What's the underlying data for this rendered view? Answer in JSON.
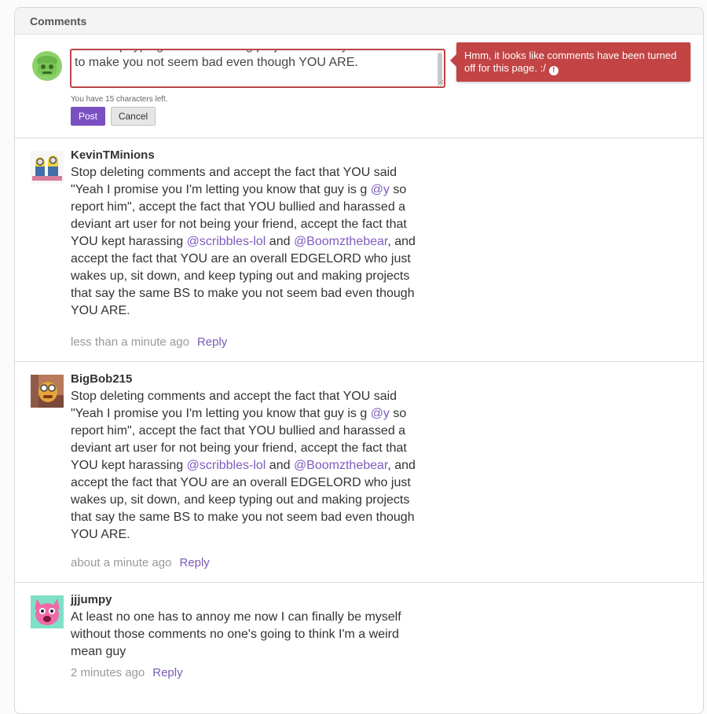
{
  "panel": {
    "title": "Comments"
  },
  "composer": {
    "text": "and keep typing out and making projects that say the same BS to make you not seem bad even though YOU ARE.",
    "chars_left": "You have 15 characters left.",
    "post_label": "Post",
    "cancel_label": "Cancel",
    "error": "Hmm, it looks like comments have been turned off for this page. :/",
    "error_icon": "exclamation-icon"
  },
  "comments": [
    {
      "author": "KevinTMinions",
      "avatar": "minions-avatar",
      "body": {
        "p1": "Stop deleting comments and accept the fact that YOU said \"Yeah I promise you I'm letting you know that guy is g ",
        "m1": "@y",
        "p2": " so report him\", accept the fact that YOU bullied and harassed a deviant art user for not being your friend, accept the fact that YOU kept harassing ",
        "m2": "@scribbles-lol",
        "p3": " and ",
        "m3": "@Boomzthebear",
        "p4": ", and accept the fact that YOU are an overall EDGELORD who just wakes up, sit down, and keep typing out and making projects that say the same BS to make you not seem bad even though YOU ARE."
      },
      "time": "less than a minute ago",
      "reply": "Reply"
    },
    {
      "author": "BigBob215",
      "avatar": "bob-avatar",
      "body": {
        "p1": "Stop deleting comments and accept the fact that YOU said \"Yeah I promise you I'm letting you know that guy is g ",
        "m1": "@y",
        "p2": " so report him\", accept the fact that YOU bullied and harassed a deviant art user for not being your friend, accept the fact that YOU kept harassing ",
        "m2": "@scribbles-lol",
        "p3": " and ",
        "m3": "@Boomzthebear",
        "p4": ", and accept the fact that YOU are an overall EDGELORD who just wakes up, sit down, and keep typing out and making projects that say the same BS to make you not seem bad even though YOU ARE."
      },
      "time": "about a minute ago",
      "reply": "Reply"
    },
    {
      "author": "jjjumpy",
      "avatar": "pink-creature-avatar",
      "body": "At least no one has to annoy me now I can finally be myself without those comments no one's going to think I'm a weird mean guy",
      "time": "2 minutes ago",
      "reply": "Reply"
    }
  ],
  "colors": {
    "accent": "#7a4fc2",
    "error": "#c24444",
    "mention": "#7e5bbf"
  }
}
